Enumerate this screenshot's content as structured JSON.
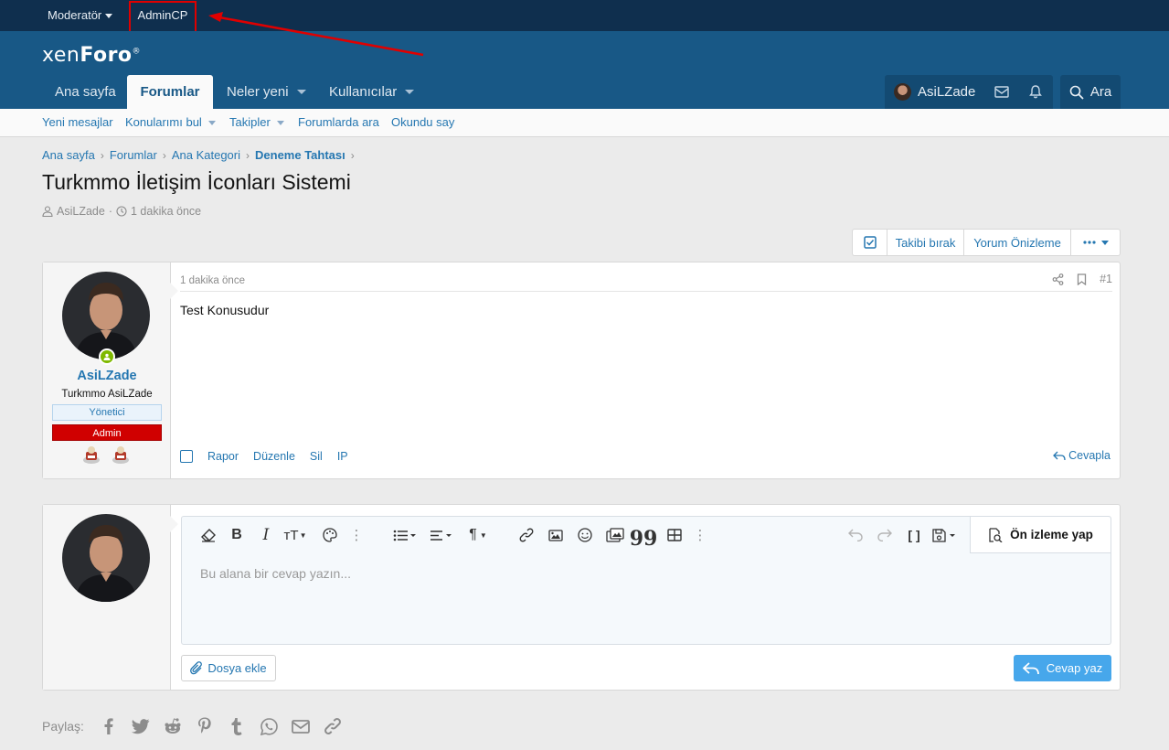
{
  "staffbar": {
    "moderator": "Moderatör",
    "admincp": "AdminCP"
  },
  "header": {
    "logo_light": "xen",
    "logo_bold": "Foro",
    "logo_mark": "®",
    "tabs": [
      {
        "label": "Ana sayfa",
        "active": false
      },
      {
        "label": "Forumlar",
        "active": true
      },
      {
        "label": "Neler yeni",
        "active": false,
        "dropdown": true
      },
      {
        "label": "Kullanıcılar",
        "active": false,
        "dropdown": true
      }
    ],
    "username": "AsiLZade",
    "search_label": "Ara"
  },
  "subnav": [
    "Yeni mesajlar",
    "Konularımı bul",
    "Takipler",
    "Forumlarda ara",
    "Okundu say"
  ],
  "breadcrumb": [
    "Ana sayfa",
    "Forumlar",
    "Ana Kategori",
    "Deneme Tahtası"
  ],
  "thread": {
    "title": "Turkmmo İletişim İconları Sistemi",
    "author": "AsiLZade",
    "time": "1 dakika önce"
  },
  "thread_buttons": {
    "unwatch": "Takibi bırak",
    "preview": "Yorum Önizleme"
  },
  "post": {
    "username": "AsiLZade",
    "user_title": "Turkmmo AsiLZade",
    "banner_staff": "Yönetici",
    "banner_admin": "Admin",
    "date": "1 dakika önce",
    "number": "#1",
    "content": "Test Konusudur",
    "actions": [
      "Rapor",
      "Düzenle",
      "Sil",
      "IP"
    ],
    "reply": "Cevapla"
  },
  "editor": {
    "preview": "Ön izleme yap",
    "placeholder": "Bu alana bir cevap yazın...",
    "attach": "Dosya ekle",
    "submit": "Cevap yaz"
  },
  "share": {
    "label": "Paylaş:"
  },
  "colors": {
    "header": "#185886",
    "staffbar": "#0f2f4e",
    "link": "#2577b1",
    "annotation": "#e00000",
    "submit": "#47a7eb"
  }
}
